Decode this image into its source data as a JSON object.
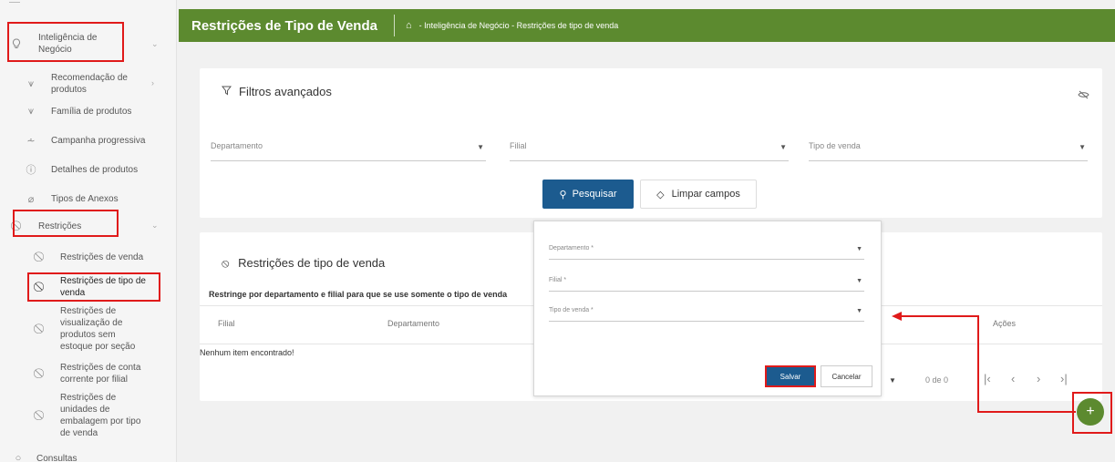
{
  "sidebar": {
    "items": [
      {
        "label": "Inteligência de\nNegócio",
        "icon": "lightbulb-icon"
      },
      {
        "label": "Recomendação de\nprodutos",
        "icon": "cart-icon"
      },
      {
        "label": "Família de produtos",
        "icon": "cart-icon"
      },
      {
        "label": "Campanha progressiva",
        "icon": "chart-icon"
      },
      {
        "label": "Detalhes de produtos",
        "icon": "info-icon"
      },
      {
        "label": "Tipos de Anexos",
        "icon": "paperclip-icon"
      },
      {
        "label": "Restrições",
        "icon": "block-icon"
      },
      {
        "label": "Restrições de venda",
        "icon": "block-icon"
      },
      {
        "label": "Restrições de tipo de\nvenda",
        "icon": "block-icon"
      },
      {
        "label": "Restrições de\nvisualização de\nprodutos sem\nestoque por seção",
        "icon": "block-icon"
      },
      {
        "label": "Restrições de conta\ncorrente por filial",
        "icon": "block-icon"
      },
      {
        "label": "Restrições de\nunidades de\nembalagem por tipo\nde venda",
        "icon": "block-icon"
      },
      {
        "label": "Consultas",
        "icon": "circle-icon"
      }
    ]
  },
  "header": {
    "title": "Restrições de Tipo de Venda",
    "breadcrumb": "- Inteligência de Negócio - Restrições de tipo de venda"
  },
  "filters": {
    "title": "Filtros avançados",
    "fields": [
      "Departamento",
      "Filial",
      "Tipo de venda"
    ],
    "search_label": "Pesquisar",
    "clear_label": "Limpar campos"
  },
  "restrictions": {
    "title": "Restrições de tipo de venda",
    "description": "Restringe por departamento e filial para que se use somente o tipo de venda",
    "columns": [
      "Filial",
      "Departamento",
      "Ações"
    ],
    "empty_text": "Nenhum item encontrado!",
    "pager_count": "0 de 0"
  },
  "modal": {
    "fields": [
      "Departamento *",
      "Filial *",
      "Tipo de venda *"
    ],
    "save_label": "Salvar",
    "cancel_label": "Cancelar"
  },
  "fab": {
    "label": "+"
  },
  "colors": {
    "header": "#5c8a2f",
    "primary": "#1c5b8f",
    "highlight": "#e01a1a"
  }
}
